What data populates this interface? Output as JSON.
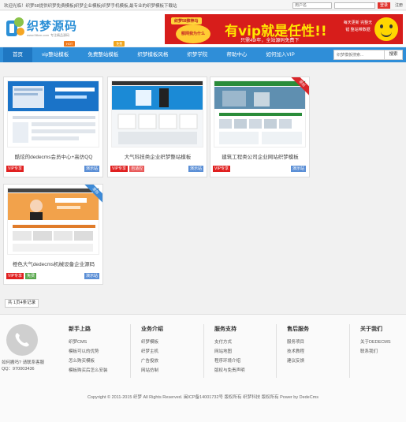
{
  "topbar": {
    "welcome": "欢迎光临！织梦58提供织梦免费模板|织梦企业模板|织梦手机模板,最专业的织梦模板下载站",
    "username_placeholder": "用户名",
    "password_placeholder": "",
    "login_label": "登录",
    "register_label": "注册"
  },
  "header": {
    "logo_name": "织梦源码",
    "logo_url": "www.58cm.com",
    "logo_slogan": "专注精品源码"
  },
  "banner": {
    "tag": "织梦58推神马",
    "circle": "额网我为什么",
    "headline": "有vip就是任性!!",
    "sub": "只需49/年，全站源码免费下",
    "right": "每天更新 完整无错 整站带数据"
  },
  "nav": {
    "items": [
      {
        "label": "首页",
        "active": true,
        "badge": ""
      },
      {
        "label": "vip整站模板",
        "active": false,
        "badge": "HOT"
      },
      {
        "label": "免费整站模板",
        "active": false,
        "badge": "免费"
      },
      {
        "label": "织梦模板风格",
        "active": false,
        "badge": ""
      },
      {
        "label": "织梦学院",
        "active": false,
        "badge": ""
      },
      {
        "label": "帮助中心",
        "active": false,
        "badge": ""
      },
      {
        "label": "如何加入VIP",
        "active": false,
        "badge": ""
      }
    ],
    "search_placeholder": "织梦模板搜索...",
    "search_button": "搜索"
  },
  "cards": [
    {
      "title": "酷炫的dedecms会员中心+高仿QQ",
      "tags": [
        {
          "label": "VIP专享",
          "kind": "vip"
        }
      ],
      "demo": "演示站",
      "ribbon": ""
    },
    {
      "title": "大气科技类企业织梦整站模板",
      "tags": [
        {
          "label": "VIP专享",
          "kind": "vip"
        },
        {
          "label": "自适应",
          "kind": "red"
        }
      ],
      "demo": "演示站",
      "ribbon": ""
    },
    {
      "title": "建筑工程类公司企业网站织梦模板",
      "tags": [
        {
          "label": "VIP专享",
          "kind": "vip"
        }
      ],
      "demo": "演示站",
      "ribbon": "原创"
    },
    {
      "title": "橙色大气dedecms机械设备企业源码",
      "tags": [
        {
          "label": "VIP专享",
          "kind": "vip"
        },
        {
          "label": "免费",
          "kind": "green"
        }
      ],
      "demo": "演示站",
      "ribbon": "原创"
    }
  ],
  "pager": "共 1页4条记录",
  "footer": {
    "contact_line1": "如何搬吗? 请联系客服",
    "contact_line2": "QQ：970003436",
    "columns": [
      {
        "title": "新手上路",
        "items": [
          "织梦CMS",
          "模板可以的优势",
          "怎么购买模板",
          "模板购买后怎么安装"
        ]
      },
      {
        "title": "业务介绍",
        "items": [
          "织梦模板",
          "织梦主机",
          "广告投放",
          "网站仿制"
        ]
      },
      {
        "title": "服务支持",
        "items": [
          "支付方式",
          "网站地图",
          "程序环境介绍",
          "版权与免责声明"
        ]
      },
      {
        "title": "售后服务",
        "items": [
          "服务项目",
          "技术教程",
          "建议反馈"
        ]
      },
      {
        "title": "关于我们",
        "items": [
          "关于DEDECMS",
          "联系我们"
        ]
      }
    ],
    "copyright": "Copyright © 2011-2015 织梦 All Rights Reserved. 闽ICP备14001732号 版权所有 织梦科技 版权所有 Power by DedeCms"
  },
  "colors": {
    "nav": "#2f8ed8",
    "vip": "#e02020",
    "demo": "#5b8fd6",
    "banner": "#d71d1b"
  }
}
